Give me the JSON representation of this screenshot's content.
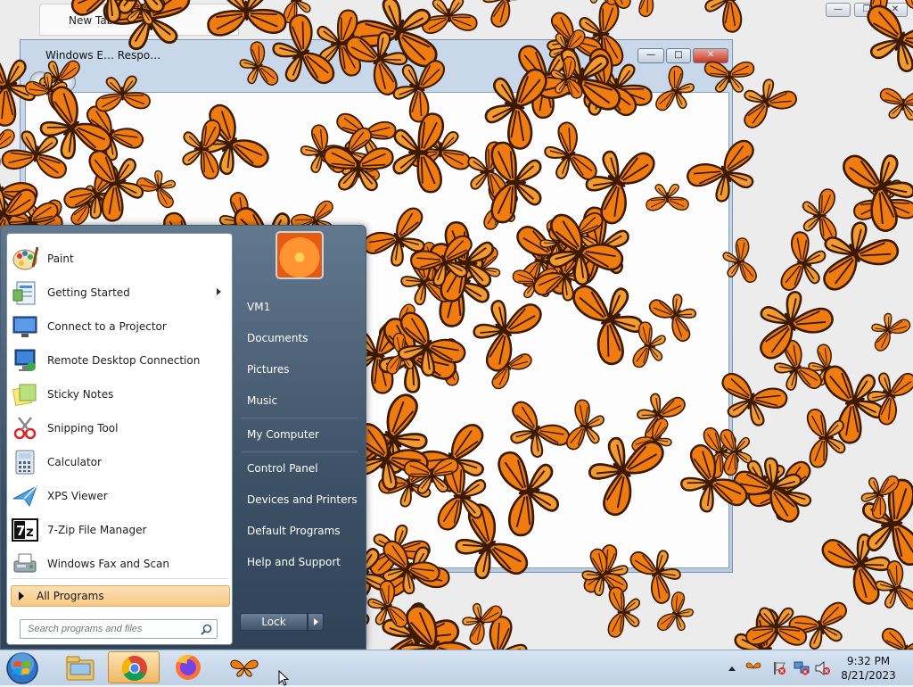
{
  "browser": {
    "tab_title": "New Tab"
  },
  "explorer": {
    "title": "Windows E… Respo…"
  },
  "start_menu": {
    "programs": [
      {
        "label": "Paint",
        "icon": "paint-icon",
        "has_submenu": false
      },
      {
        "label": "Getting Started",
        "icon": "getting-started-icon",
        "has_submenu": true
      },
      {
        "label": "Connect to a Projector",
        "icon": "projector-icon",
        "has_submenu": false
      },
      {
        "label": "Remote Desktop Connection",
        "icon": "remote-desktop-icon",
        "has_submenu": false
      },
      {
        "label": "Sticky Notes",
        "icon": "sticky-notes-icon",
        "has_submenu": false
      },
      {
        "label": "Snipping Tool",
        "icon": "snipping-tool-icon",
        "has_submenu": false
      },
      {
        "label": "Calculator",
        "icon": "calculator-icon",
        "has_submenu": false
      },
      {
        "label": "XPS Viewer",
        "icon": "xps-viewer-icon",
        "has_submenu": false
      },
      {
        "label": "7-Zip File Manager",
        "icon": "seven-zip-icon",
        "has_submenu": false
      },
      {
        "label": "Windows Fax and Scan",
        "icon": "fax-scan-icon",
        "has_submenu": false
      }
    ],
    "all_programs_label": "All Programs",
    "search_placeholder": "Search programs and files",
    "places": [
      {
        "label": "VM1"
      },
      {
        "label": "Documents"
      },
      {
        "label": "Pictures"
      },
      {
        "label": "Music"
      },
      {
        "label": "My Computer"
      },
      {
        "label": "Control Panel"
      },
      {
        "label": "Devices and Printers"
      },
      {
        "label": "Default Programs"
      },
      {
        "label": "Help and Support"
      }
    ],
    "lock_label": "Lock"
  },
  "taskbar": {
    "items": [
      {
        "name": "windows-explorer-icon"
      },
      {
        "name": "chrome-icon",
        "active": true
      },
      {
        "name": "firefox-icon"
      },
      {
        "name": "butterfly-app-icon"
      }
    ],
    "clock_time": "9:32 PM",
    "clock_date": "8/21/2023"
  },
  "colors": {
    "butterfly_orange": "#f07c10",
    "butterfly_dark": "#3a1a05",
    "start_menu_dark": "#3d5166",
    "all_programs_highlight": "#f9d39a"
  }
}
